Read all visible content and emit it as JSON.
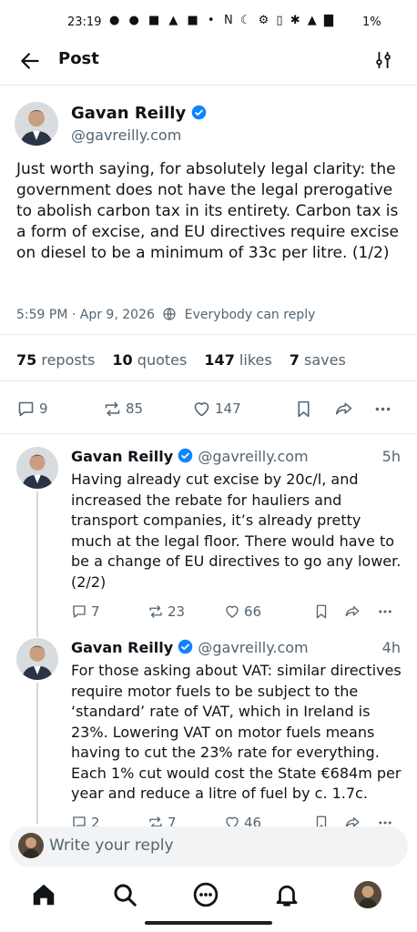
{
  "status_bar": {
    "time": "23:19",
    "notifications": "● ● ■ ▲ ■ •",
    "system": "N ☾ ⚙ ▯ ✱ ▲ ▇",
    "battery": "1%"
  },
  "header": {
    "title": "Post"
  },
  "main_post": {
    "author_name": "Gavan Reilly",
    "author_handle": "@gavreilly.com",
    "text": "Just worth saying, for absolutely legal clarity: the government does not have the legal prerogative to abolish carbon tax in its entirety. Carbon tax is a form of excise, and EU directives require excise on diesel to be a minimum of 33c per litre. (1/2)",
    "timestamp": "5:59 PM · Apr 9, 2026",
    "reply_setting": "Everybody can reply",
    "stats": {
      "reposts_count": "75",
      "reposts_label": "reposts",
      "quotes_count": "10",
      "quotes_label": "quotes",
      "likes_count": "147",
      "likes_label": "likes",
      "saves_count": "7",
      "saves_label": "saves"
    },
    "actions": {
      "replies": "9",
      "reposts": "85",
      "likes": "147"
    }
  },
  "replies": [
    {
      "author_name": "Gavan Reilly",
      "author_handle": "@gavreilly.com",
      "time": "5h",
      "text": "Having already cut excise by 20c/l, and increased the rebate for hauliers and transport companies, it’s already pretty much at the legal floor. There would have to be a change of EU directives to go any lower. (2/2)",
      "replies": "7",
      "reposts": "23",
      "likes": "66"
    },
    {
      "author_name": "Gavan Reilly",
      "author_handle": "@gavreilly.com",
      "time": "4h",
      "text": "For those asking about VAT: similar directives require motor fuels to be subject to the ‘standard’ rate of VAT, which in Ireland is 23%. Lowering VAT on motor fuels means having to cut the 23% rate for everything. Each 1% cut would cost the State €684m per year and reduce a litre of fuel by c. 1.7c.",
      "replies": "2",
      "reposts": "7",
      "likes": "46"
    }
  ],
  "compose": {
    "placeholder": "Write your reply"
  },
  "colors": {
    "accent": "#1083fe",
    "text": "#0f1419",
    "muted": "#536471",
    "divider": "#e7e9eb"
  }
}
